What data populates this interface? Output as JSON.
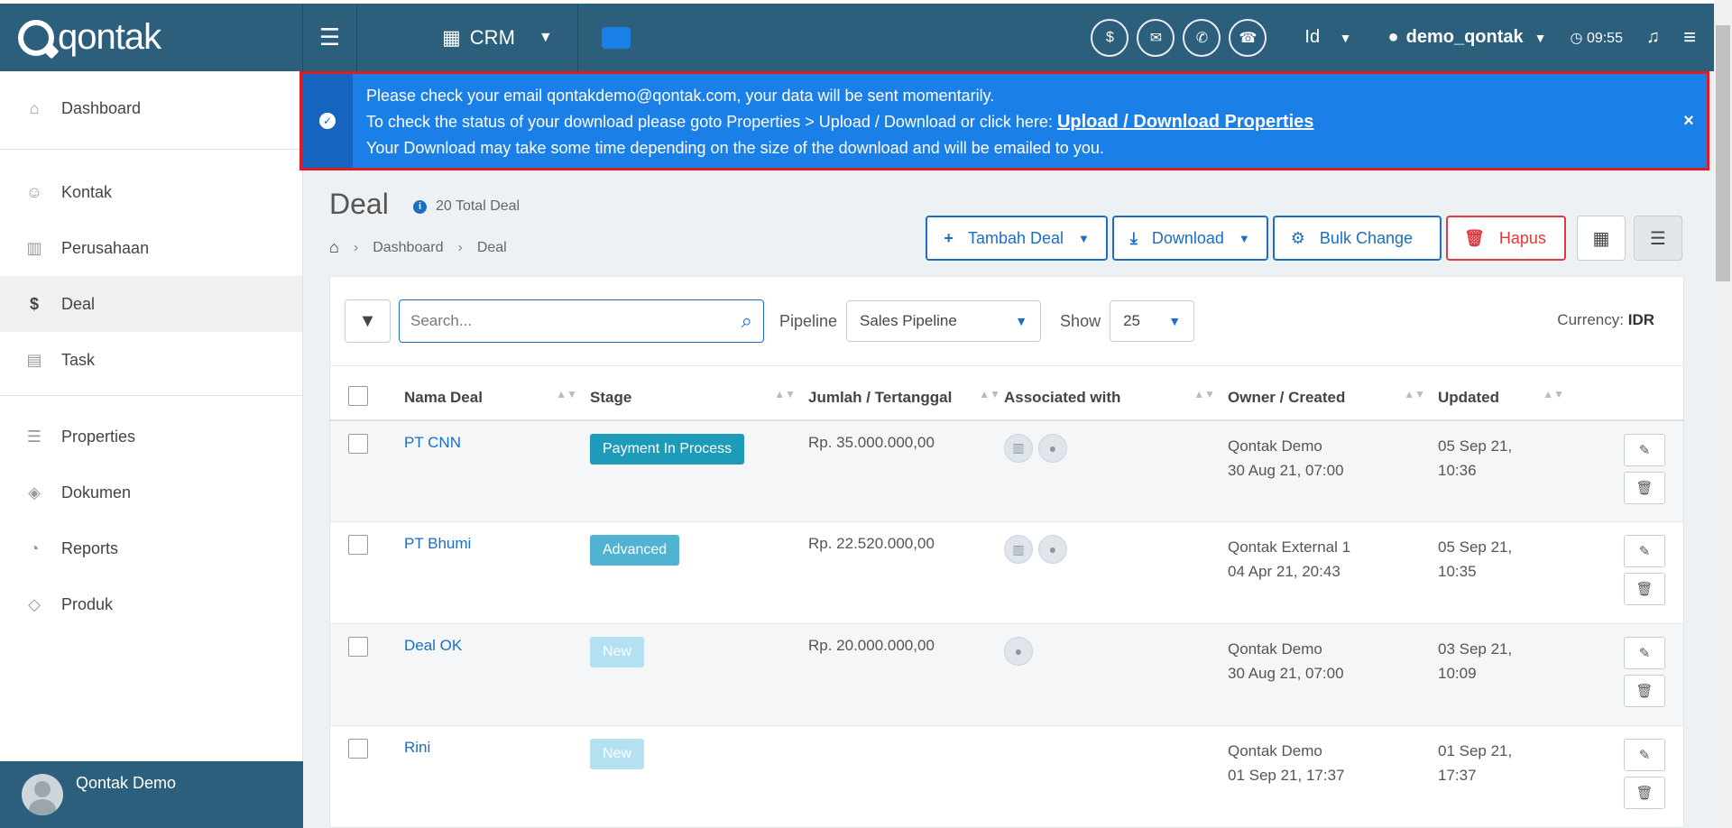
{
  "brand": {
    "logo_text": "qontak"
  },
  "topbar": {
    "app_name": "CRM",
    "language": "Id",
    "username": "demo_qontak",
    "time": "09:55"
  },
  "sidebar": {
    "items": [
      {
        "label": "Dashboard",
        "icon": "home-icon"
      },
      {
        "label": "Kontak",
        "icon": "users-icon"
      },
      {
        "label": "Perusahaan",
        "icon": "building-icon"
      },
      {
        "label": "Deal",
        "icon": "dollar-icon",
        "active": true
      },
      {
        "label": "Task",
        "icon": "calendar-icon"
      },
      {
        "label": "Properties",
        "icon": "list-icon"
      },
      {
        "label": "Dokumen",
        "icon": "layers-icon"
      },
      {
        "label": "Reports",
        "icon": "pie-chart-icon"
      },
      {
        "label": "Produk",
        "icon": "tag-icon"
      }
    ],
    "user_name": "Qontak Demo"
  },
  "alert": {
    "line1": "Please check your email qontakdemo@qontak.com, your data will be sent momentarily.",
    "line2_prefix": "To check the status of your download please goto Properties > Upload / Download or click here: ",
    "line2_link": "Upload / Download Properties",
    "line3": "Your Download may take some time depending on the size of the download and will be emailed to you.",
    "close": "×"
  },
  "page": {
    "title": "Deal",
    "total": "20 Total Deal",
    "breadcrumb": [
      "Dashboard",
      "Deal"
    ]
  },
  "actions": {
    "add": "Tambah Deal",
    "download": "Download",
    "bulk": "Bulk Change",
    "delete": "Hapus"
  },
  "toolbar": {
    "search_placeholder": "Search...",
    "pipeline_label": "Pipeline",
    "pipeline_value": "Sales Pipeline",
    "show_label": "Show",
    "show_value": "25",
    "currency_label": "Currency:",
    "currency_value": "IDR"
  },
  "table": {
    "headers": [
      "Nama Deal",
      "Stage",
      "Jumlah / Tertanggal",
      "Associated with",
      "Owner / Created",
      "Updated"
    ],
    "rows": [
      {
        "name": "PT CNN",
        "stage": "Payment In Process",
        "stage_color": "#1e9bb8",
        "amount": "Rp. 35.000.000,00",
        "owner": "Qontak Demo",
        "created": "30 Aug 21, 07:00",
        "updated_date": "05 Sep 21,",
        "updated_time": "10:36"
      },
      {
        "name": "PT Bhumi",
        "stage": "Advanced",
        "stage_color": "#4fb3d1",
        "amount": "Rp. 22.520.000,00",
        "owner": "Qontak External 1",
        "created": "04 Apr 21, 20:43",
        "updated_date": "05 Sep 21,",
        "updated_time": "10:35"
      },
      {
        "name": "Deal OK",
        "stage": "New",
        "stage_color": "#b3e1f1",
        "amount": "Rp. 20.000.000,00",
        "owner": "Qontak Demo",
        "created": "30 Aug 21, 07:00",
        "updated_date": "03 Sep 21,",
        "updated_time": "10:09"
      },
      {
        "name": "Rini",
        "stage": "New",
        "stage_color": "#b3e1f1",
        "amount": "",
        "owner": "Qontak Demo",
        "created": "01 Sep 21, 17:37",
        "updated_date": "01 Sep 21,",
        "updated_time": "17:37"
      }
    ]
  }
}
